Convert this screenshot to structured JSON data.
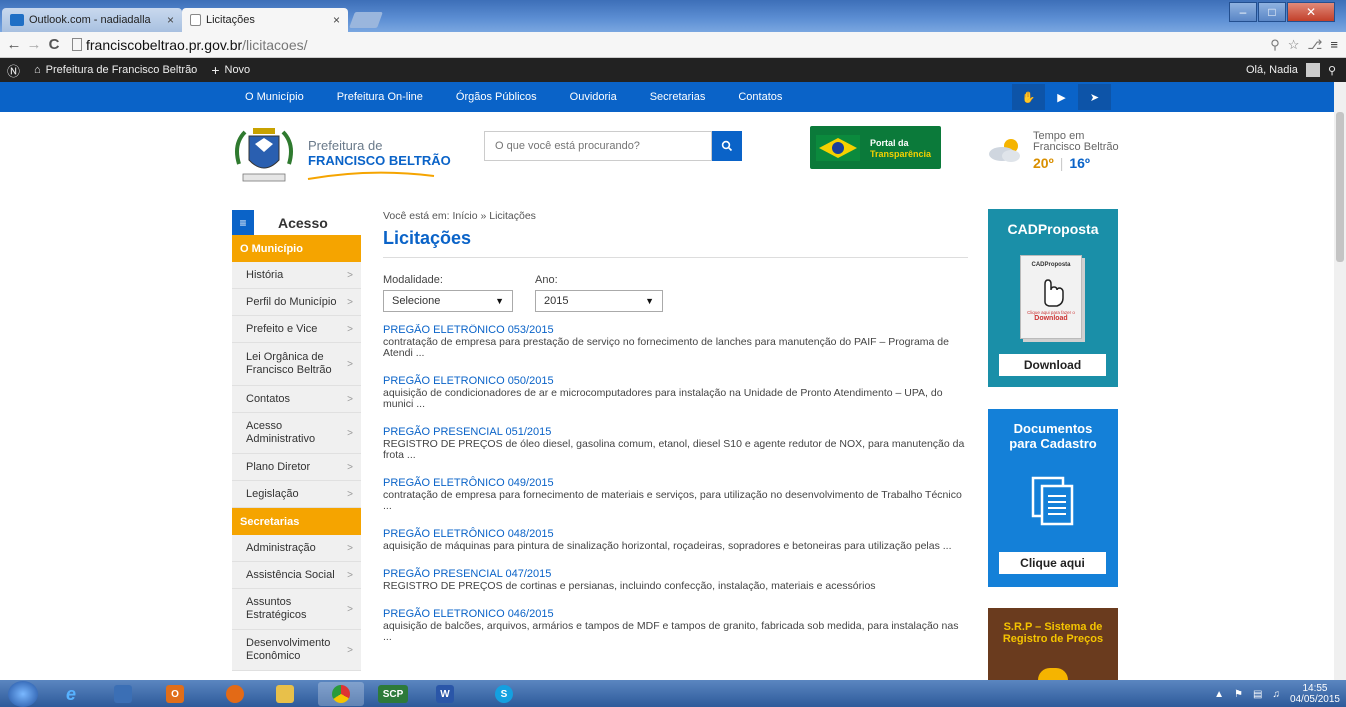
{
  "browser": {
    "tabs": [
      {
        "label": "Outlook.com - nadiadalla",
        "close": "×"
      },
      {
        "label": "Licitações",
        "close": "×"
      }
    ],
    "url_host": "franciscobeltrao.pr.gov.br",
    "url_path": "/licitacoes/"
  },
  "wp_admin_bar": {
    "site_name": "Prefeitura de Francisco Beltrão",
    "new_label": "Novo",
    "greeting": "Olá, Nadia"
  },
  "site_nav": {
    "items": [
      "O Município",
      "Prefeitura On-line",
      "Órgãos Públicos",
      "Ouvidoria",
      "Secretarias",
      "Contatos"
    ]
  },
  "header": {
    "brand_top": "Prefeitura de",
    "brand_main": "FRANCISCO BELTRÃO",
    "search_placeholder": "O que você está procurando?",
    "portal_line1": "Portal da",
    "portal_line2": "Transparência",
    "weather_line1": "Tempo em",
    "weather_line2": "Francisco Beltrão",
    "temp_max": "20º",
    "temp_min": "16º",
    "temp_sep": "|"
  },
  "sidebar": {
    "title": "Acesso",
    "section1": "O Município",
    "items1": [
      "História",
      "Perfil do Município",
      "Prefeito e Vice",
      "Lei Orgânica de Francisco Beltrão",
      "Contatos",
      "Acesso Administrativo",
      "Plano Diretor",
      "Legislação"
    ],
    "section2": "Secretarias",
    "items2": [
      "Administração",
      "Assistência Social",
      "Assuntos Estratégicos",
      "Desenvolvimento Econômico"
    ],
    "arrow": ">"
  },
  "main": {
    "breadcrumb": "Você está em: Início » Licitações",
    "title": "Licitações",
    "modalidade_label": "Modalidade:",
    "modalidade_value": "Selecione",
    "ano_label": "Ano:",
    "ano_value": "2015",
    "results": [
      {
        "title": "PREGÃO ELETRÔNICO 053/2015",
        "desc": "contratação de empresa para prestação de serviço no fornecimento de lanches para manutenção do PAIF – Programa de Atendi ..."
      },
      {
        "title": "PREGÃO ELETRONICO 050/2015",
        "desc": "aquisição de condicionadores de ar e microcomputadores para instalação na Unidade de Pronto Atendimento – UPA, do munici ..."
      },
      {
        "title": "PREGÃO PRESENCIAL 051/2015",
        "desc": "REGISTRO DE PREÇOS de óleo diesel, gasolina comum, etanol, diesel S10 e agente redutor de NOX, para manutenção da frota ..."
      },
      {
        "title": "PREGÃO ELETRÔNICO 049/2015",
        "desc": "contratação de empresa para fornecimento de materiais e serviços, para utilização no desenvolvimento de Trabalho Técnico ..."
      },
      {
        "title": "PREGÃO ELETRÔNICO 048/2015",
        "desc": "aquisição de máquinas para pintura de sinalização horizontal, roçadeiras, sopradores e betoneiras para utilização pelas ..."
      },
      {
        "title": "PREGÃO PRESENCIAL 047/2015",
        "desc": "REGISTRO DE PREÇOS de cortinas e persianas, incluindo confecção, instalação, materiais e acessórios"
      },
      {
        "title": "PREGÃO ELETRONICO 046/2015",
        "desc": "aquisição de balcões, arquivos, armários e tampos de MDF e tampos de granito, fabricada sob medida, para instalação nas ..."
      }
    ]
  },
  "widgets": {
    "cad_title": "CADProposta",
    "cad_box_label": "CADProposta",
    "cad_box_hint": "Clique aqui para fazer o",
    "cad_box_download": "Download",
    "cad_button": "Download",
    "doc_title_line1": "Documentos",
    "doc_title_line2": "para Cadastro",
    "doc_button": "Clique aqui",
    "srp_title_line1": "S.R.P – Sistema de",
    "srp_title_line2": "Registro de Preços"
  },
  "taskbar": {
    "scp_label": "SCP",
    "time": "14:55",
    "date": "04/05/2015"
  },
  "colors": {
    "primary_blue": "#0a63c8",
    "orange": "#f5a400",
    "teal": "#1a8fa8",
    "green": "#0b7a3a"
  }
}
